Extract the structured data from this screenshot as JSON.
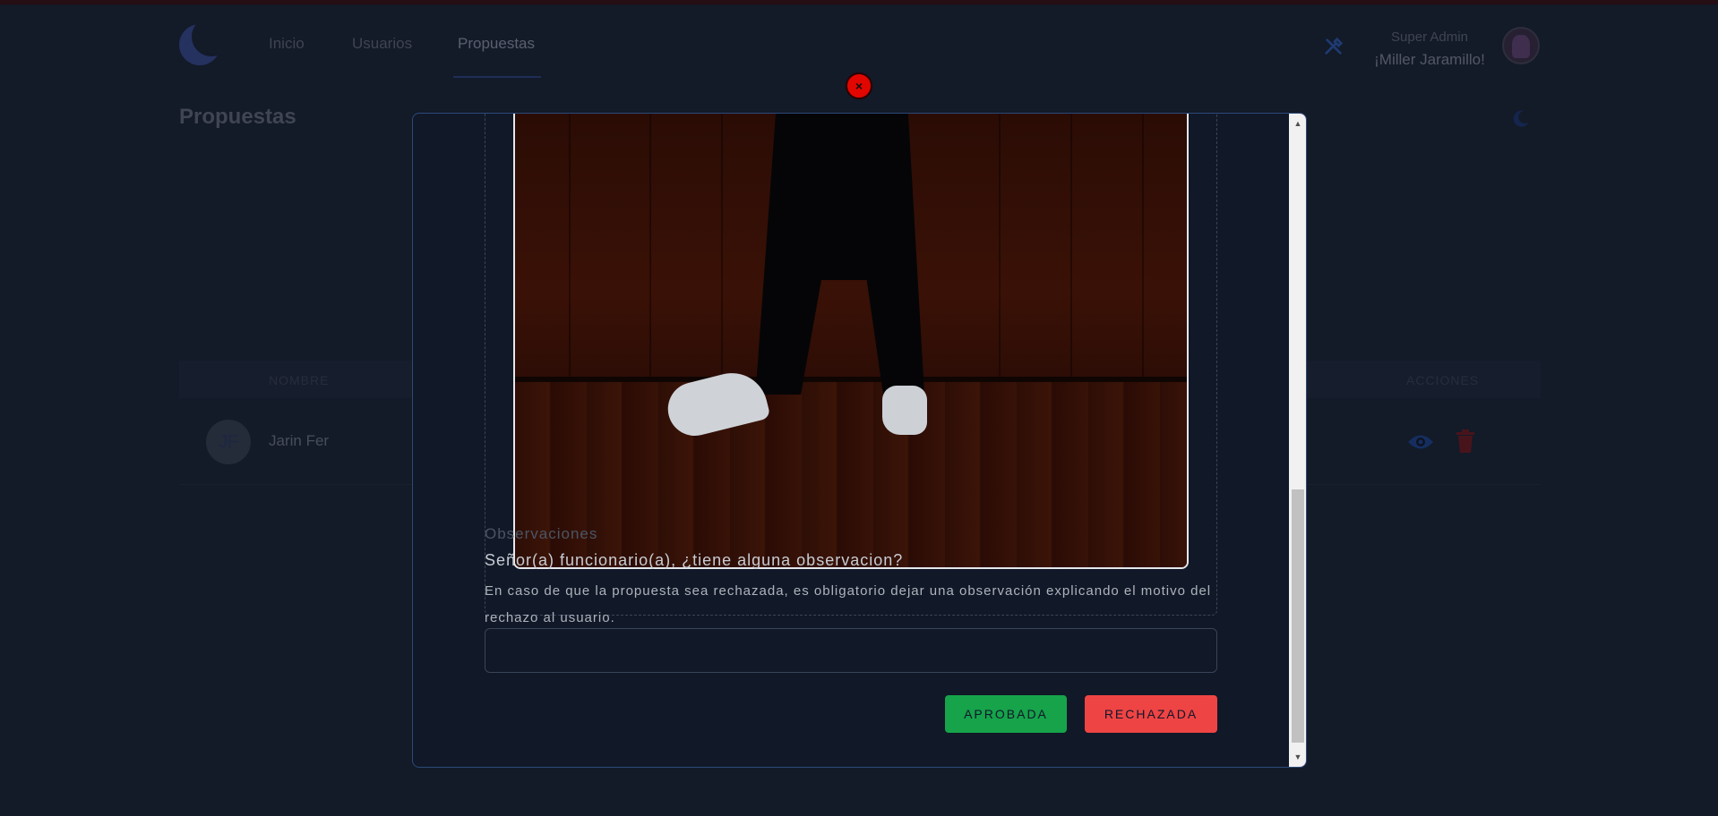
{
  "nav": {
    "links": [
      {
        "label": "Inicio"
      },
      {
        "label": "Usuarios"
      },
      {
        "label": "Propuestas"
      }
    ],
    "user": {
      "role": "Super Admin",
      "greeting": "¡Miller Jaramillo!"
    }
  },
  "page": {
    "title": "Propuestas"
  },
  "table": {
    "headers": [
      "NOMBRE",
      "ACCIONES"
    ],
    "rows": [
      {
        "initials": "JF",
        "name": "Jarin Fer"
      }
    ]
  },
  "modal": {
    "close_symbol": "×",
    "observaciones_label": "Observaciones",
    "question": "Señor(a) funcionario(a), ¿tiene alguna observacion?",
    "help_text": "En caso de que la propuesta sea rechazada, es obligatorio dejar una observación explicando el motivo del rechazo al usuario.",
    "input_value": "",
    "approve_label": "APROBADA",
    "reject_label": "RECHAZADA",
    "scroll_up": "▲",
    "scroll_down": "▼"
  },
  "colors": {
    "approve": "#16a34a",
    "reject": "#ef4444",
    "close": "#e10600",
    "accent_blue": "#2f5fb8"
  },
  "icons": [
    "tools-icon",
    "moon-icon",
    "eye-icon",
    "trash-icon",
    "close-icon"
  ]
}
